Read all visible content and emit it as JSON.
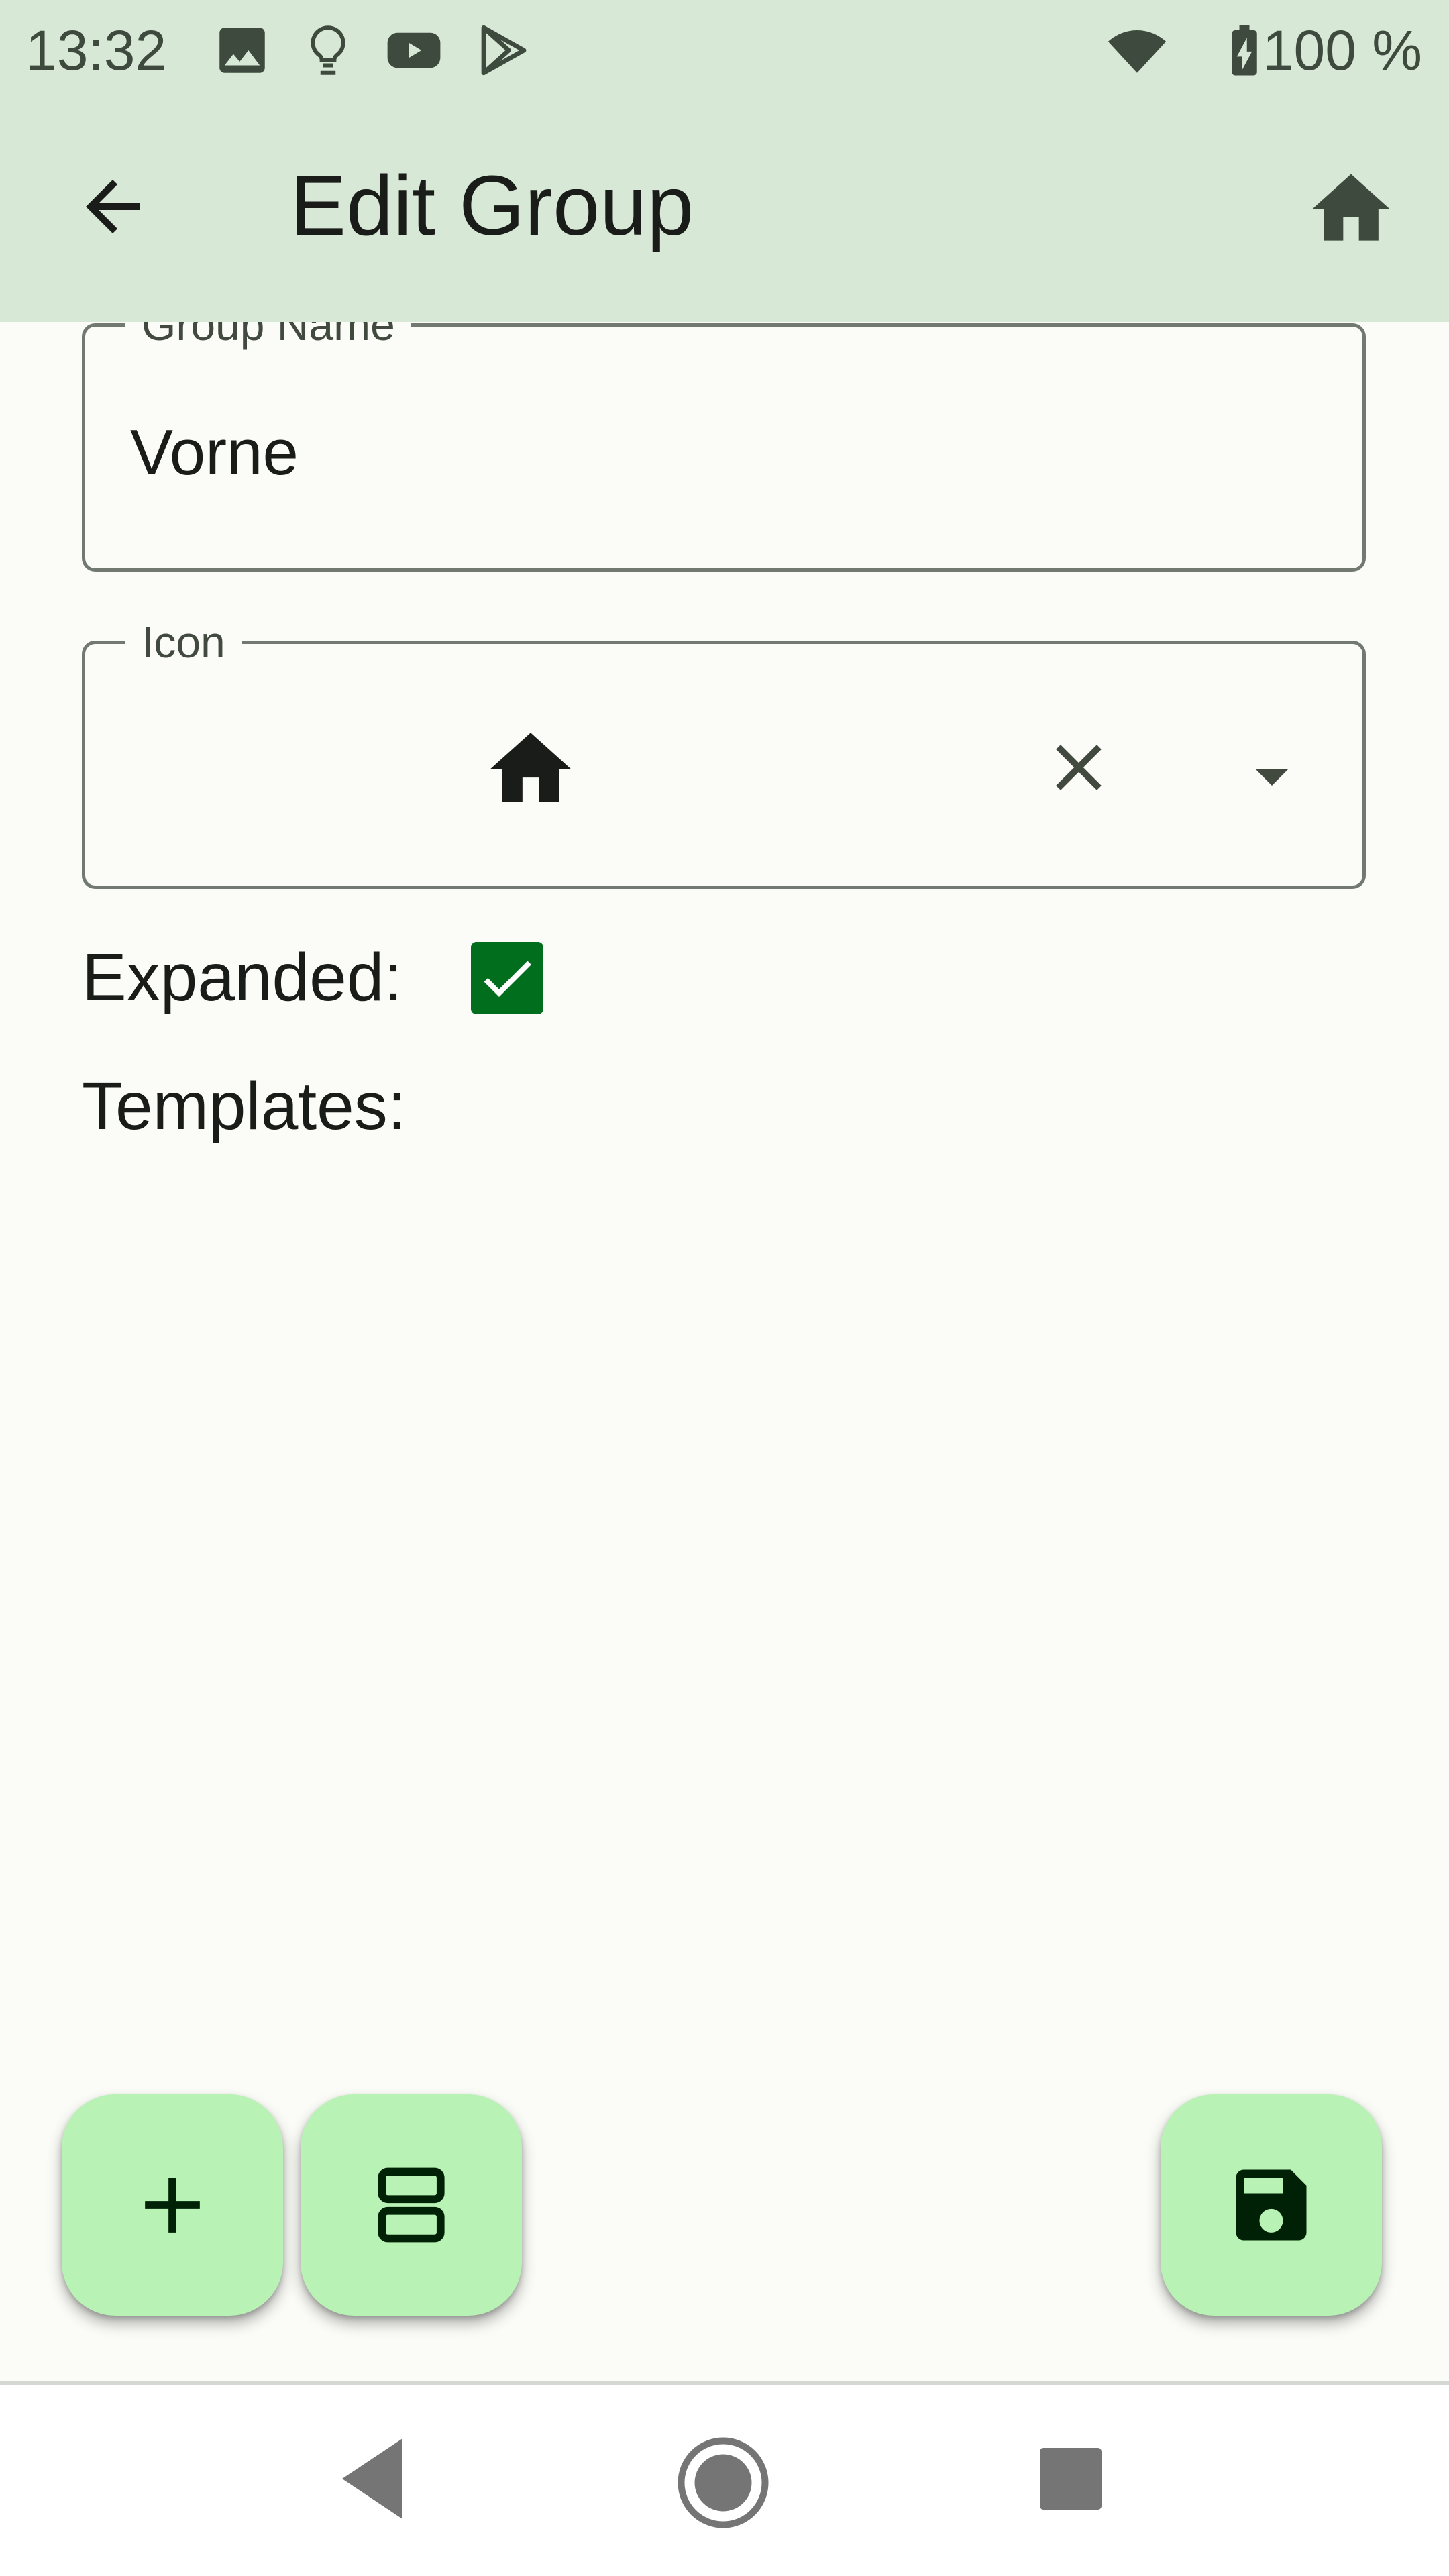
{
  "status_bar": {
    "time": "13:32",
    "battery_text": "100 %",
    "icons": [
      "image-icon",
      "lightbulb-icon",
      "youtube-icon",
      "play-store-icon",
      "wifi-icon",
      "battery-charging-icon"
    ]
  },
  "app_bar": {
    "title": "Edit Group",
    "back_icon": "arrow-back-icon",
    "home_icon": "home-icon"
  },
  "form": {
    "group_name": {
      "label": "Group Name",
      "value": "Vorne"
    },
    "icon": {
      "label": "Icon",
      "selected_icon": "home-icon",
      "clear_icon": "close-icon",
      "dropdown_icon": "dropdown-arrow-icon"
    },
    "expanded": {
      "label": "Expanded:",
      "checked": true
    },
    "templates": {
      "label": "Templates:"
    }
  },
  "fabs": {
    "add": "add-icon",
    "layout": "view-agenda-icon",
    "save": "save-icon"
  },
  "colors": {
    "app_bar_bg": "#D7E8D6",
    "background": "#FBFCF7",
    "fab_bg": "#B8F2B4",
    "checkbox": "#006E1C"
  }
}
